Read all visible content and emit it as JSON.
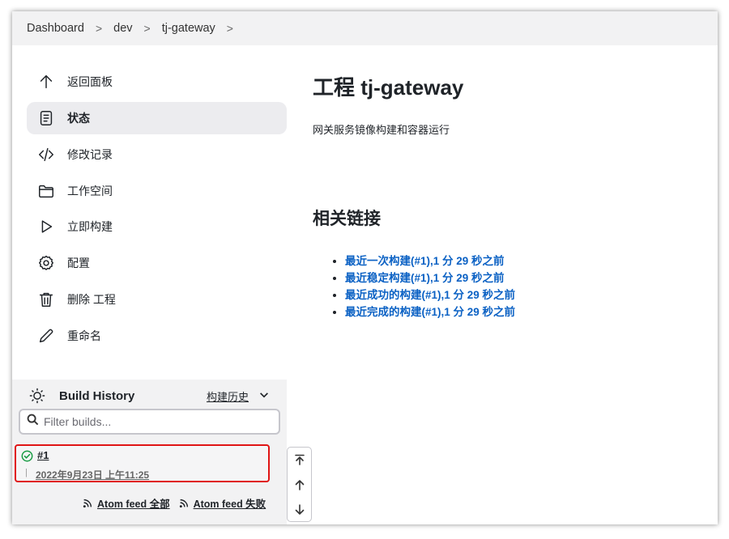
{
  "breadcrumb": {
    "items": [
      "Dashboard",
      "dev",
      "tj-gateway"
    ],
    "separator": ">"
  },
  "sidebar": {
    "tasks": [
      {
        "label": "返回面板",
        "icon": "arrow-up-icon"
      },
      {
        "label": "状态",
        "icon": "document-icon",
        "active": true
      },
      {
        "label": "修改记录",
        "icon": "code-icon"
      },
      {
        "label": "工作空间",
        "icon": "folder-icon"
      },
      {
        "label": "立即构建",
        "icon": "play-icon"
      },
      {
        "label": "配置",
        "icon": "gear-icon"
      },
      {
        "label": "删除 工程",
        "icon": "trash-icon"
      },
      {
        "label": "重命名",
        "icon": "pencil-icon"
      }
    ]
  },
  "build_history": {
    "title": "Build History",
    "trend_label": "构建历史",
    "filter_placeholder": "Filter builds...",
    "builds": [
      {
        "number": "#1",
        "time": "2022年9月23日 上午11:25",
        "status": "success"
      }
    ],
    "feeds": [
      {
        "label": "Atom feed 全部"
      },
      {
        "label": "Atom feed 失败"
      }
    ]
  },
  "main": {
    "title": "工程 tj-gateway",
    "description": "网关服务镜像构建和容器运行",
    "links_title": "相关链接",
    "links": [
      "最近一次构建(#1),1 分 29 秒之前",
      "最近稳定构建(#1),1 分 29 秒之前",
      "最近成功的构建(#1),1 分 29 秒之前",
      "最近完成的构建(#1),1 分 29 秒之前"
    ]
  },
  "colors": {
    "link": "#0b61c4",
    "highlight_border": "#e01515",
    "success": "#1a9c45",
    "panel_bg": "#f2f2f3"
  }
}
